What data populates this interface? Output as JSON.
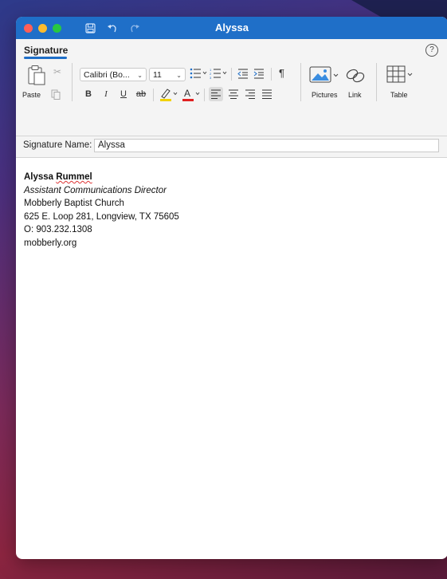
{
  "window": {
    "title": "Alyssa"
  },
  "ribbon": {
    "tab": "Signature",
    "help": "?",
    "paste_label": "Paste",
    "font_name": "Calibri (Bo...",
    "font_size": "11",
    "bold": "B",
    "italic": "I",
    "underline": "U",
    "strike": "ab",
    "pictures_label": "Pictures",
    "link_label": "Link",
    "table_label": "Table",
    "pilcrow": "¶"
  },
  "name_bar": {
    "label": "Signature Name:",
    "value": "Alyssa"
  },
  "signature": {
    "first_name": "Alyssa",
    "last_name": "Rummel",
    "title": "Assistant Communications Director",
    "org": "Mobberly Baptist Church",
    "address": "625 E. Loop 281, Longview, TX 75605",
    "phone": "O: 903.232.1308",
    "website": "mobberly.org"
  },
  "colors": {
    "titlebar": "#1f6fc8",
    "close": "#fe5f57",
    "minimize": "#febc2e",
    "zoom": "#28c840",
    "highlight": "#f2d200",
    "font_color": "#e02020"
  }
}
